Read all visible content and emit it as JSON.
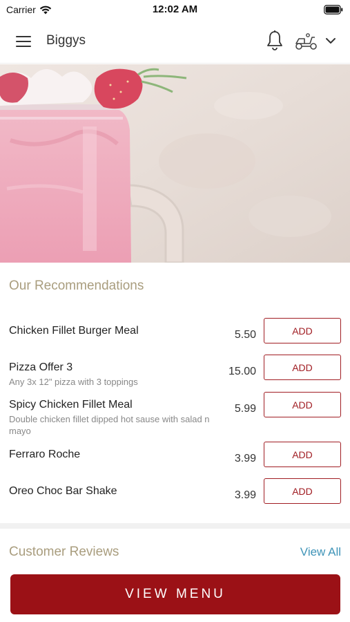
{
  "status_bar": {
    "carrier": "Carrier",
    "time": "12:02 AM"
  },
  "header": {
    "title": "Biggys"
  },
  "recommendations": {
    "heading": "Our Recommendations",
    "items": [
      {
        "name": "Chicken Fillet Burger Meal",
        "description": "",
        "price": "5.50",
        "add_label": "ADD"
      },
      {
        "name": "Pizza Offer 3",
        "description": "Any 3x 12\" pizza with 3 toppings",
        "price": "15.00",
        "add_label": "ADD"
      },
      {
        "name": "Spicy Chicken Fillet Meal",
        "description": "Double chicken fillet dipped hot sause with salad n mayo",
        "price": "5.99",
        "add_label": "ADD"
      },
      {
        "name": "Ferraro Roche",
        "description": "",
        "price": "3.99",
        "add_label": "ADD"
      },
      {
        "name": "Oreo Choc Bar Shake",
        "description": "",
        "price": "3.99",
        "add_label": "ADD"
      }
    ]
  },
  "reviews": {
    "heading": "Customer Reviews",
    "view_all": "View All"
  },
  "footer": {
    "view_menu": "VIEW MENU"
  },
  "colors": {
    "accent": "#9b1116",
    "heading": "#a99d7e",
    "link": "#3f94b8"
  },
  "icons": [
    "wifi-icon",
    "battery-icon",
    "hamburger-menu-icon",
    "bell-icon",
    "delivery-scooter-icon",
    "chevron-down-icon"
  ]
}
